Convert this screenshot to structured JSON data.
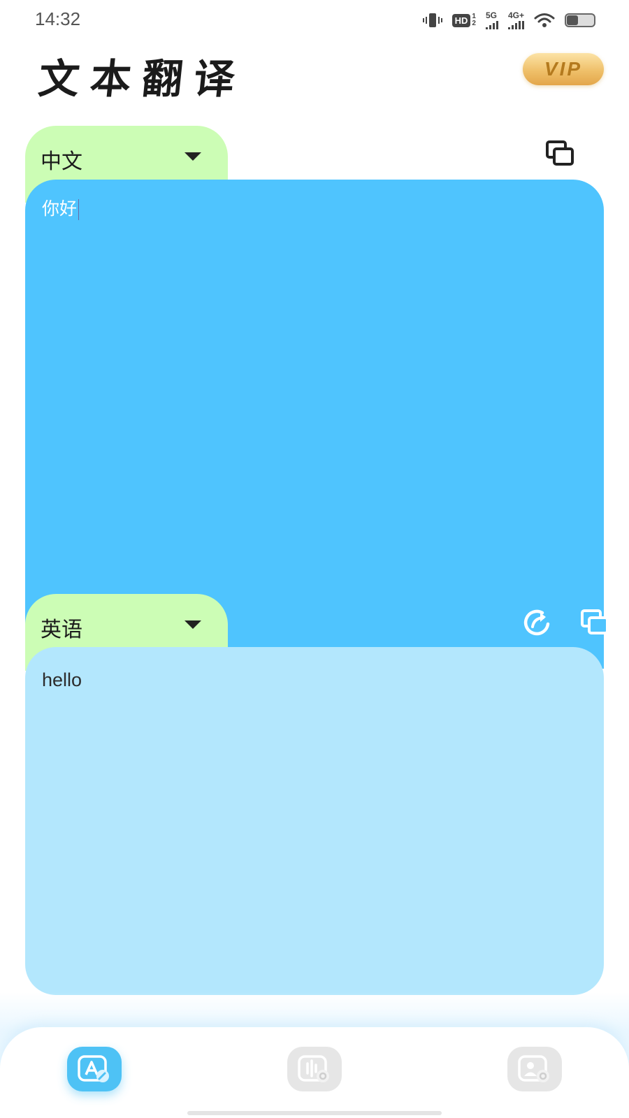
{
  "status_bar": {
    "time": "14:32",
    "hd_label": "HD",
    "hd_sub_top": "1",
    "hd_sub_bottom": "2",
    "net_5g": "5G",
    "net_4g": "4G+",
    "icons": [
      "vibrate-icon",
      "hd-icon",
      "signal-5g-icon",
      "signal-4g-icon",
      "wifi-icon",
      "battery-icon"
    ]
  },
  "header": {
    "title": "文本翻译",
    "vip_label": "VIP"
  },
  "source": {
    "language": "中文",
    "text": "你好"
  },
  "target": {
    "language": "英语",
    "text": "hello"
  },
  "bottom_nav": {
    "items": [
      {
        "icon": "text-translate-icon",
        "active": true
      },
      {
        "icon": "voice-translate-icon",
        "active": false
      },
      {
        "icon": "profile-icon",
        "active": false
      }
    ]
  },
  "colors": {
    "source_panel": "#4fc4fe",
    "target_panel": "#b3e7fd",
    "language_tab": "#ccfdb5",
    "vip_gold": "#efc06a",
    "nav_active": "#4ec2f5"
  }
}
